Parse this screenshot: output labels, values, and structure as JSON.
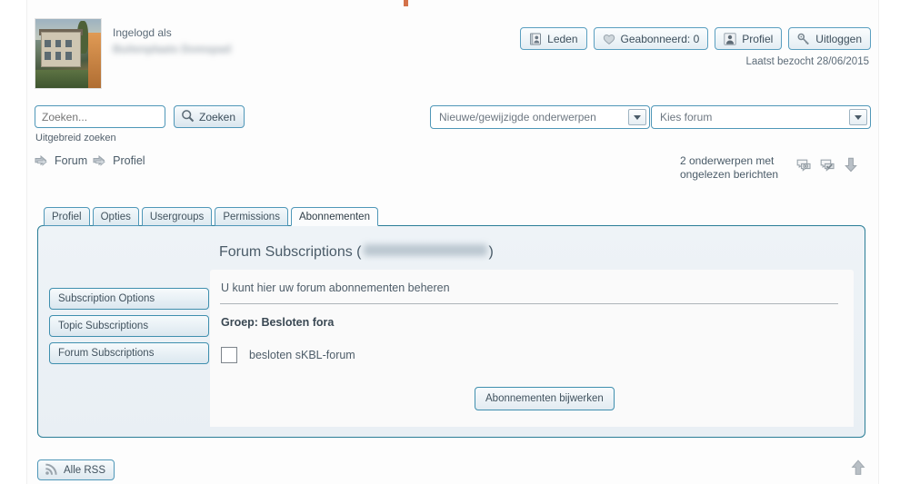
{
  "header": {
    "logged_in_label": "Ingelogd als",
    "username_redacted": "Buitenplaats Domspad",
    "avatar_alt": "user-avatar-photo",
    "last_visit": "Laatst bezocht 28/06/2015",
    "buttons": [
      {
        "label": "Leden",
        "icon": "members-icon",
        "name": "members-button"
      },
      {
        "label": "Geabonneerd: 0",
        "icon": "heart-icon",
        "name": "subscribed-button"
      },
      {
        "label": "Profiel",
        "icon": "user-icon",
        "name": "profile-button"
      },
      {
        "label": "Uitloggen",
        "icon": "key-icon",
        "name": "logout-button"
      }
    ]
  },
  "search": {
    "placeholder": "Zoeken...",
    "value": "",
    "button_label": "Zoeken",
    "advanced_label": "Uitgebreid zoeken",
    "topics_select": "Nieuwe/gewijzigde onderwerpen",
    "forum_select": "Kies forum"
  },
  "breadcrumb": {
    "items": [
      {
        "label": "Forum"
      },
      {
        "label": "Profiel"
      }
    ]
  },
  "unread": {
    "text": "2 onderwerpen met ongelezen berichten",
    "icons": [
      "new-posts-icon",
      "mark-read-icon",
      "jump-to-bottom-icon"
    ]
  },
  "tabs": [
    {
      "label": "Profiel",
      "active": false
    },
    {
      "label": "Opties",
      "active": false
    },
    {
      "label": "Usergroups",
      "active": false
    },
    {
      "label": "Permissions",
      "active": false
    },
    {
      "label": "Abonnementen",
      "active": true
    }
  ],
  "panel": {
    "title_prefix": "Forum Subscriptions (",
    "title_suffix": ")",
    "title_user_redacted": "Buitenplaats Domspad",
    "side_menu": [
      {
        "label": "Subscription Options"
      },
      {
        "label": "Topic Subscriptions"
      },
      {
        "label": "Forum Subscriptions"
      }
    ],
    "lead_text": "U kunt hier uw forum abonnementen beheren",
    "group_title": "Groep: Besloten fora",
    "checkboxes": [
      {
        "label": "besloten sKBL-forum",
        "checked": false
      }
    ],
    "submit_label": "Abonnementen bijwerken"
  },
  "footer": {
    "rss_label": "Alle RSS",
    "rss_icon": "rss-icon",
    "top_icon": "scroll-to-top-icon"
  },
  "colors": {
    "accent_border": "#2a7d96",
    "button_border": "#4f97b8",
    "panel_bg": "#eef3f7",
    "content_bg": "#fafafa",
    "text": "#4a5b68"
  }
}
